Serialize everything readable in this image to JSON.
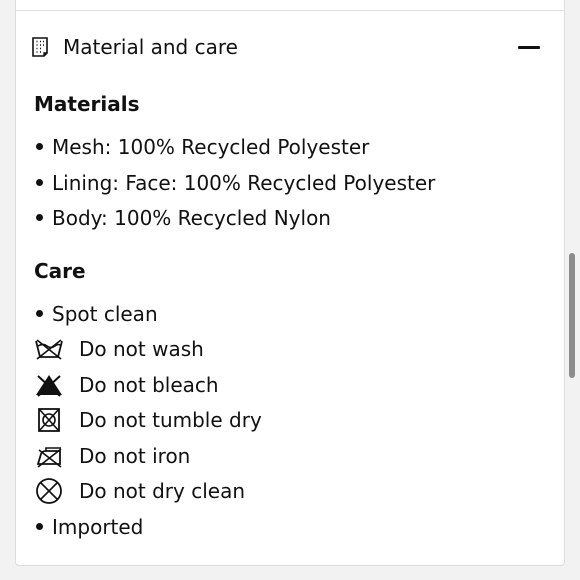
{
  "accordion": {
    "title": "Material and care",
    "icon": "fabric-tag-icon",
    "toggle_icon": "minus-icon"
  },
  "materials": {
    "heading": "Materials",
    "items": [
      "Mesh: 100% Recycled Polyester",
      "Lining: Face: 100% Recycled Polyester",
      "Body: 100% Recycled Nylon"
    ]
  },
  "care": {
    "heading": "Care",
    "items": [
      {
        "text": "Spot clean",
        "icon": "bullet"
      },
      {
        "text": "Do not wash",
        "icon": "do-not-wash-icon"
      },
      {
        "text": "Do not bleach",
        "icon": "do-not-bleach-icon"
      },
      {
        "text": "Do not tumble dry",
        "icon": "do-not-tumble-dry-icon"
      },
      {
        "text": "Do not iron",
        "icon": "do-not-iron-icon"
      },
      {
        "text": "Do not dry clean",
        "icon": "do-not-dry-clean-icon"
      },
      {
        "text": "Imported",
        "icon": "bullet"
      }
    ]
  }
}
